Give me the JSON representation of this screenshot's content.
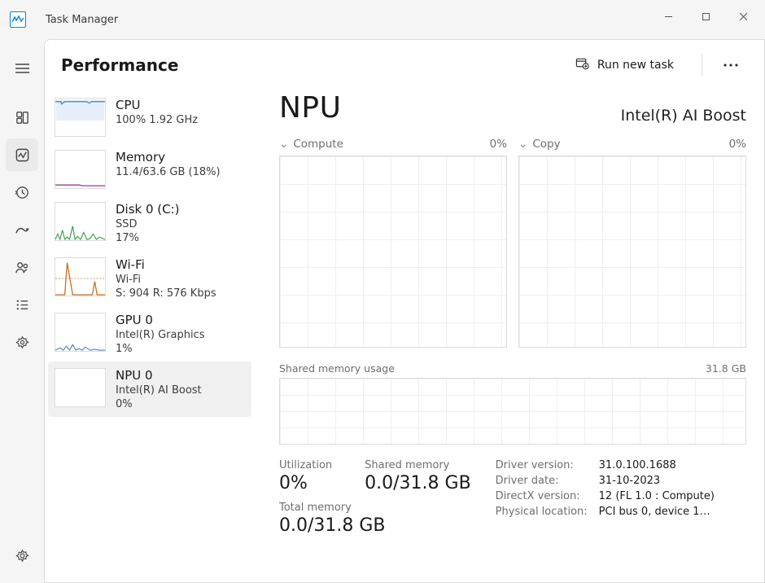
{
  "window": {
    "title": "Task Manager"
  },
  "header": {
    "page_title": "Performance",
    "run_task_label": "Run new task"
  },
  "rail": {
    "icons": {
      "hamburger": "hamburger",
      "processes": "processes-icon",
      "performance": "performance-icon",
      "history": "history-icon",
      "startup": "startup-icon",
      "users": "users-icon",
      "details": "details-icon",
      "services": "services-icon",
      "settings": "settings-icon"
    }
  },
  "items": [
    {
      "title": "CPU",
      "sub1": "100%  1.92 GHz",
      "sub2": ""
    },
    {
      "title": "Memory",
      "sub1": "11.4/63.6 GB (18%)",
      "sub2": ""
    },
    {
      "title": "Disk 0 (C:)",
      "sub1": "SSD",
      "sub2": "17%"
    },
    {
      "title": "Wi-Fi",
      "sub1": "Wi-Fi",
      "sub2": "S: 904 R: 576 Kbps"
    },
    {
      "title": "GPU 0",
      "sub1": "Intel(R) Graphics",
      "sub2": "1%"
    },
    {
      "title": "NPU 0",
      "sub1": "Intel(R) AI Boost",
      "sub2": "0%"
    }
  ],
  "detail": {
    "title": "NPU",
    "subtitle": "Intel(R) AI Boost",
    "compute_label": "Compute",
    "compute_value": "0%",
    "copy_label": "Copy",
    "copy_value": "0%",
    "shared_label": "Shared memory usage",
    "shared_max": "31.8 GB",
    "stats": {
      "utilization_label": "Utilization",
      "utilization_value": "0%",
      "shared_mem_label": "Shared memory",
      "shared_mem_value": "0.0/31.8 GB",
      "total_mem_label": "Total memory",
      "total_mem_value": "0.0/31.8 GB"
    },
    "info": {
      "driver_version_k": "Driver version:",
      "driver_version_v": "31.0.100.1688",
      "driver_date_k": "Driver date:",
      "driver_date_v": "31-10-2023",
      "directx_k": "DirectX version:",
      "directx_v": "12 (FL 1.0 : Compute)",
      "location_k": "Physical location:",
      "location_v": "PCI bus 0, device 1…"
    }
  },
  "chart_data": [
    {
      "type": "line",
      "title": "Compute",
      "ylabel": "%",
      "ylim": [
        0,
        100
      ],
      "x": [],
      "values": [],
      "note": "0% flat, no data points visible"
    },
    {
      "type": "line",
      "title": "Copy",
      "ylabel": "%",
      "ylim": [
        0,
        100
      ],
      "x": [],
      "values": [],
      "note": "0% flat, no data points visible"
    },
    {
      "type": "line",
      "title": "Shared memory usage",
      "ylabel": "GB",
      "ylim": [
        0,
        31.8
      ],
      "x": [],
      "values": [],
      "note": "0.0 GB flat"
    }
  ]
}
